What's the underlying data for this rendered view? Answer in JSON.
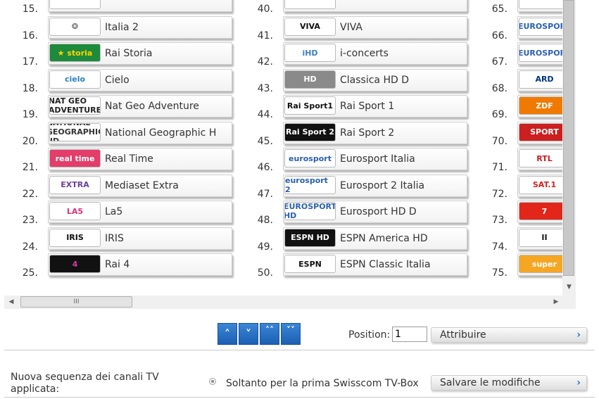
{
  "columns": [
    [
      {
        "num": "15.",
        "name": "",
        "logo": "",
        "logo_bg": "#ffffff",
        "logo_fg": "#e0306c"
      },
      {
        "num": "16.",
        "name": "Italia 2",
        "logo": "❂",
        "logo_bg": "#ffffff",
        "logo_fg": "#555555"
      },
      {
        "num": "17.",
        "name": "Rai Storia",
        "logo": "★ storia",
        "logo_bg": "#1e8a3c",
        "logo_fg": "#ffd400"
      },
      {
        "num": "18.",
        "name": "Cielo",
        "logo": "cielo",
        "logo_bg": "#ffffff",
        "logo_fg": "#2a7fc9"
      },
      {
        "num": "19.",
        "name": "Nat Geo Adventure",
        "logo": "NAT GEO ADVENTURE",
        "logo_bg": "#ffffff",
        "logo_fg": "#222222"
      },
      {
        "num": "20.",
        "name": "National Geographic H",
        "logo": "NATIONAL GEOGRAPHIC HD",
        "logo_bg": "#ffffff",
        "logo_fg": "#333333"
      },
      {
        "num": "21.",
        "name": "Real Time",
        "logo": "real time",
        "logo_bg": "#e33d6a",
        "logo_fg": "#ffffff"
      },
      {
        "num": "22.",
        "name": "Mediaset Extra",
        "logo": "EXTRA",
        "logo_bg": "#ffffff",
        "logo_fg": "#6a3fa0"
      },
      {
        "num": "23.",
        "name": "La5",
        "logo": "LA5",
        "logo_bg": "#ffffff",
        "logo_fg": "#e0307a"
      },
      {
        "num": "24.",
        "name": "IRIS",
        "logo": "IRIS",
        "logo_bg": "#ffffff",
        "logo_fg": "#111111"
      },
      {
        "num": "25.",
        "name": "Rai 4",
        "logo": "4",
        "logo_bg": "#111111",
        "logo_fg": "#d63aa8"
      }
    ],
    [
      {
        "num": "40.",
        "name": "",
        "logo": "",
        "logo_bg": "#ffffff",
        "logo_fg": "#222222"
      },
      {
        "num": "41.",
        "name": "VIVA",
        "logo": "VIVA",
        "logo_bg": "#ffffff",
        "logo_fg": "#111111"
      },
      {
        "num": "42.",
        "name": "i-concerts",
        "logo": "iHD",
        "logo_bg": "#ffffff",
        "logo_fg": "#3a7fc0"
      },
      {
        "num": "43.",
        "name": "Classica HD D",
        "logo": "HD",
        "logo_bg": "#8a8a8a",
        "logo_fg": "#ffffff"
      },
      {
        "num": "44.",
        "name": "Rai Sport 1",
        "logo": "Rai Sport1",
        "logo_bg": "#ffffff",
        "logo_fg": "#111111"
      },
      {
        "num": "45.",
        "name": "Rai Sport 2",
        "logo": "Rai Sport 2",
        "logo_bg": "#111111",
        "logo_fg": "#ffffff"
      },
      {
        "num": "46.",
        "name": "Eurosport Italia",
        "logo": "eurosport",
        "logo_bg": "#ffffff",
        "logo_fg": "#2a5fb0"
      },
      {
        "num": "47.",
        "name": "Eurosport 2 Italia",
        "logo": "eurosport 2",
        "logo_bg": "#ffffff",
        "logo_fg": "#2a5fb0"
      },
      {
        "num": "48.",
        "name": "Eurosport HD D",
        "logo": "EUROSPORT HD",
        "logo_bg": "#ffffff",
        "logo_fg": "#2a5fb0"
      },
      {
        "num": "49.",
        "name": "ESPN America HD",
        "logo": "ESPN HD",
        "logo_bg": "#111111",
        "logo_fg": "#ffffff"
      },
      {
        "num": "50.",
        "name": "ESPN Classic Italia",
        "logo": "ESPN",
        "logo_bg": "#ffffff",
        "logo_fg": "#111111"
      }
    ],
    [
      {
        "num": "65.",
        "name": "",
        "logo": "",
        "logo_bg": "#ffffff",
        "logo_fg": "#2a5fb0"
      },
      {
        "num": "66.",
        "name": "",
        "logo": "EUROSPORT",
        "logo_bg": "#ffffff",
        "logo_fg": "#2a5fb0"
      },
      {
        "num": "67.",
        "name": "",
        "logo": "EUROSPORT",
        "logo_bg": "#ffffff",
        "logo_fg": "#2a5fb0"
      },
      {
        "num": "68.",
        "name": "",
        "logo": "ARD",
        "logo_bg": "#ffffff",
        "logo_fg": "#003480"
      },
      {
        "num": "69.",
        "name": "",
        "logo": "ZDF",
        "logo_bg": "#f07a00",
        "logo_fg": "#ffffff"
      },
      {
        "num": "70.",
        "name": "",
        "logo": "SPORT",
        "logo_bg": "#cc1f1f",
        "logo_fg": "#ffffff"
      },
      {
        "num": "71.",
        "name": "",
        "logo": "RTL",
        "logo_bg": "#ffffff",
        "logo_fg": "#cc1f1f"
      },
      {
        "num": "72.",
        "name": "",
        "logo": "SAT.1",
        "logo_bg": "#ffffff",
        "logo_fg": "#d32020"
      },
      {
        "num": "73.",
        "name": "",
        "logo": "7",
        "logo_bg": "#e2261a",
        "logo_fg": "#ffffff"
      },
      {
        "num": "74.",
        "name": "",
        "logo": "II",
        "logo_bg": "#ffffff",
        "logo_fg": "#111111"
      },
      {
        "num": "75.",
        "name": "",
        "logo": "super",
        "logo_bg": "#f5a623",
        "logo_fg": "#ffffff"
      }
    ]
  ],
  "hscroll_thumb": "III",
  "nav_buttons": [
    "˄",
    "˅",
    "˄˄",
    "˅˅"
  ],
  "position_label": "Position:",
  "position_value": "1",
  "assign_button": "Attribuire",
  "status_text": "Nuova sequenza dei canali TV applicata:",
  "radio_label": "Soltanto per la prima Swisscom TV-Box",
  "save_button": "Salvare le modifiche",
  "chevron": "›",
  "accent_blue": "#1d5fb3"
}
